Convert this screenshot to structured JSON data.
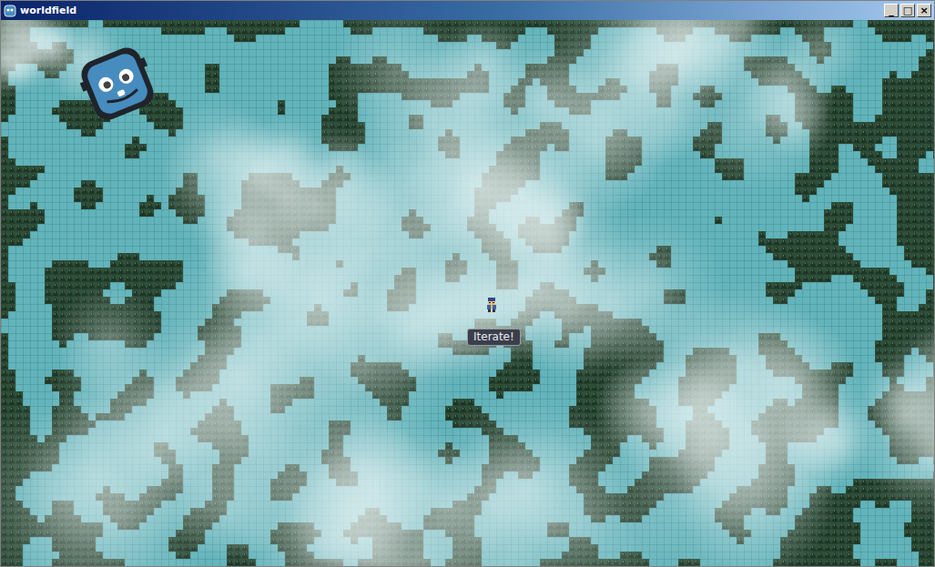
{
  "window": {
    "title": "worldfield",
    "buttons": [
      "_",
      "□",
      "×"
    ]
  },
  "tooltip": {
    "text": "Iterate!"
  }
}
